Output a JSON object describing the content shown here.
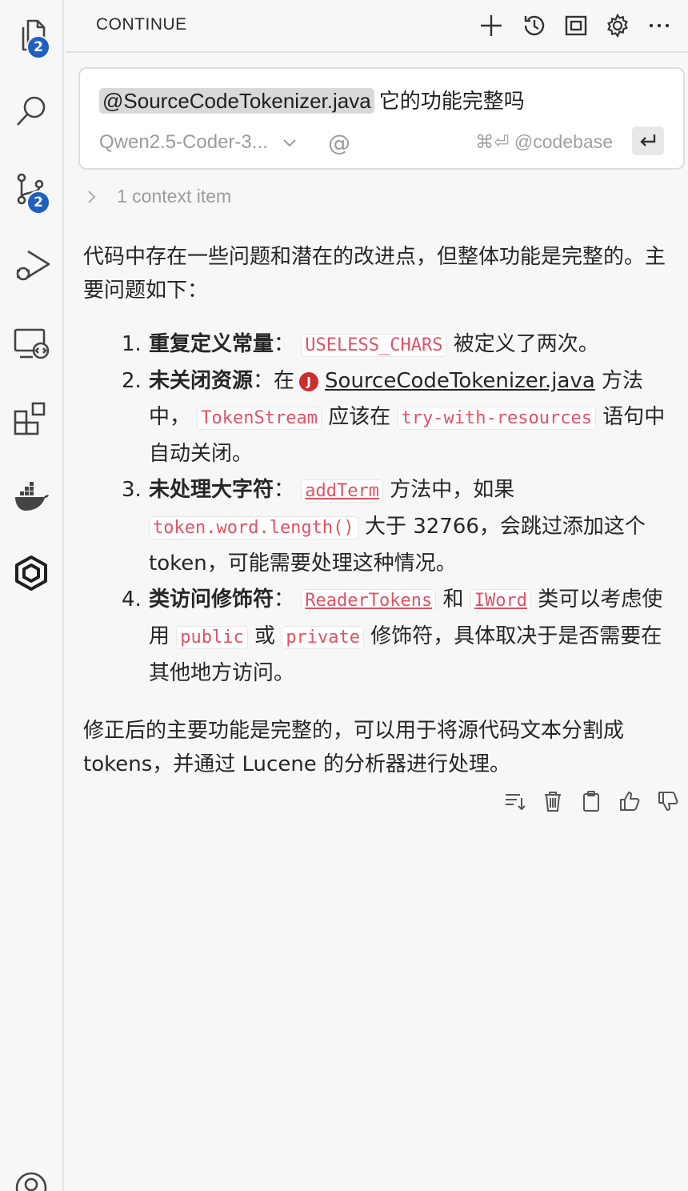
{
  "activity_bar": {
    "explorer_badge": "2",
    "scm_badge": "2"
  },
  "header": {
    "title": "CONTINUE"
  },
  "input": {
    "mention": "@SourceCodeTokenizer.java",
    "query": "它的功能完整吗",
    "model": "Qwen2.5-Coder-3...",
    "at_symbol": "@",
    "codebase_hint": "⌘⏎ @codebase"
  },
  "context": {
    "label": "1 context item"
  },
  "answer": {
    "intro": "代码中存在一些问题和潜在的改进点，但整体功能是完整的。主要问题如下：",
    "items": [
      {
        "num": "1.",
        "title": "重复定义常量",
        "colon": "：",
        "code1": "USELESS_CHARS",
        "text1": "被定义了两次。"
      },
      {
        "num": "2.",
        "title": "未关闭资源",
        "colon": "：在",
        "file_icon": "J",
        "file": "SourceCodeTokenizer.java",
        "text1": "方法中，",
        "code1": "TokenStream",
        "text2": "应该在",
        "code2": "try-with-resources",
        "text3": "语句中自动关闭。"
      },
      {
        "num": "3.",
        "title": "未处理大字符",
        "colon": "：",
        "code1": "addTerm",
        "text1": "方法中，如果",
        "code2": "token.word.length()",
        "text2": "大于 32766，会跳过添加这个 token，可能需要处理这种情况。"
      },
      {
        "num": "4.",
        "title": "类访问修饰符",
        "colon": "：",
        "code1": "ReaderTokens",
        "text1": "和",
        "code2": "IWord",
        "text2": "类可以考虑使用",
        "code3": "public",
        "text3": "或",
        "code4": "private",
        "text4": "修饰符，具体取决于是否需要在其他地方访问。"
      }
    ],
    "conclusion": "修正后的主要功能是完整的，可以用于将源代码文本分割成 tokens，并通过 Lucene 的分析器进行处理。"
  }
}
